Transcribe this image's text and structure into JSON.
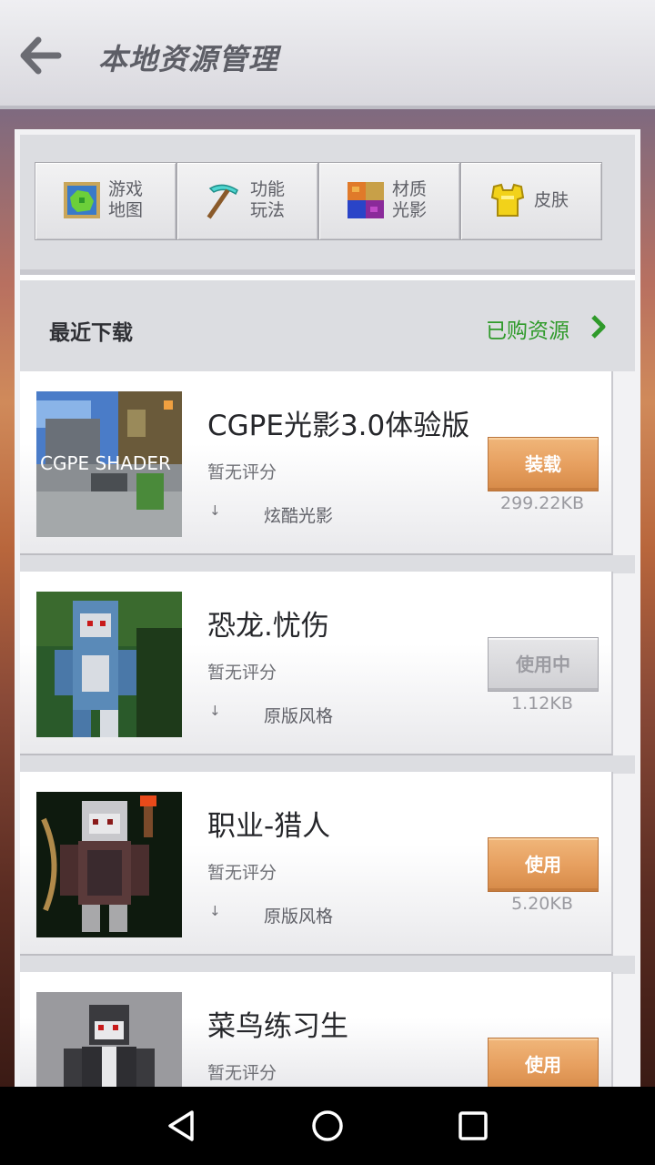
{
  "header": {
    "title": "本地资源管理",
    "back_icon": "back-arrow-icon"
  },
  "categories": [
    {
      "label": "游戏\n地图",
      "icon": "map-icon"
    },
    {
      "label": "功能\n玩法",
      "icon": "pickaxe-icon"
    },
    {
      "label": "材质\n光影",
      "icon": "texture-icon"
    },
    {
      "label": "皮肤",
      "icon": "armor-icon"
    }
  ],
  "recent": {
    "title": "最近下载",
    "purchased_link": "已购资源",
    "purchased_color": "#2f9a2a"
  },
  "items": [
    {
      "name": "CGPE光影3.0体验版",
      "rating": "暂无评分",
      "category": "炫酷光影",
      "button": "装载",
      "button_state": "active",
      "size": "299.22KB",
      "thumb_text": "CGPE SHADER"
    },
    {
      "name": "恐龙.忧伤",
      "rating": "暂无评分",
      "category": "原版风格",
      "button": "使用中",
      "button_state": "disabled",
      "size": "1.12KB"
    },
    {
      "name": "职业-猎人",
      "rating": "暂无评分",
      "category": "原版风格",
      "button": "使用",
      "button_state": "active",
      "size": "5.20KB"
    },
    {
      "name": "菜鸟练习生",
      "rating": "暂无评分",
      "category": "",
      "button": "使用",
      "button_state": "active",
      "size": ""
    }
  ],
  "navbar": {
    "back": "nav-back-icon",
    "home": "nav-home-icon",
    "recents": "nav-recents-icon"
  },
  "colors": {
    "accent_button": "#e7a060",
    "download_arrow": "↓"
  }
}
